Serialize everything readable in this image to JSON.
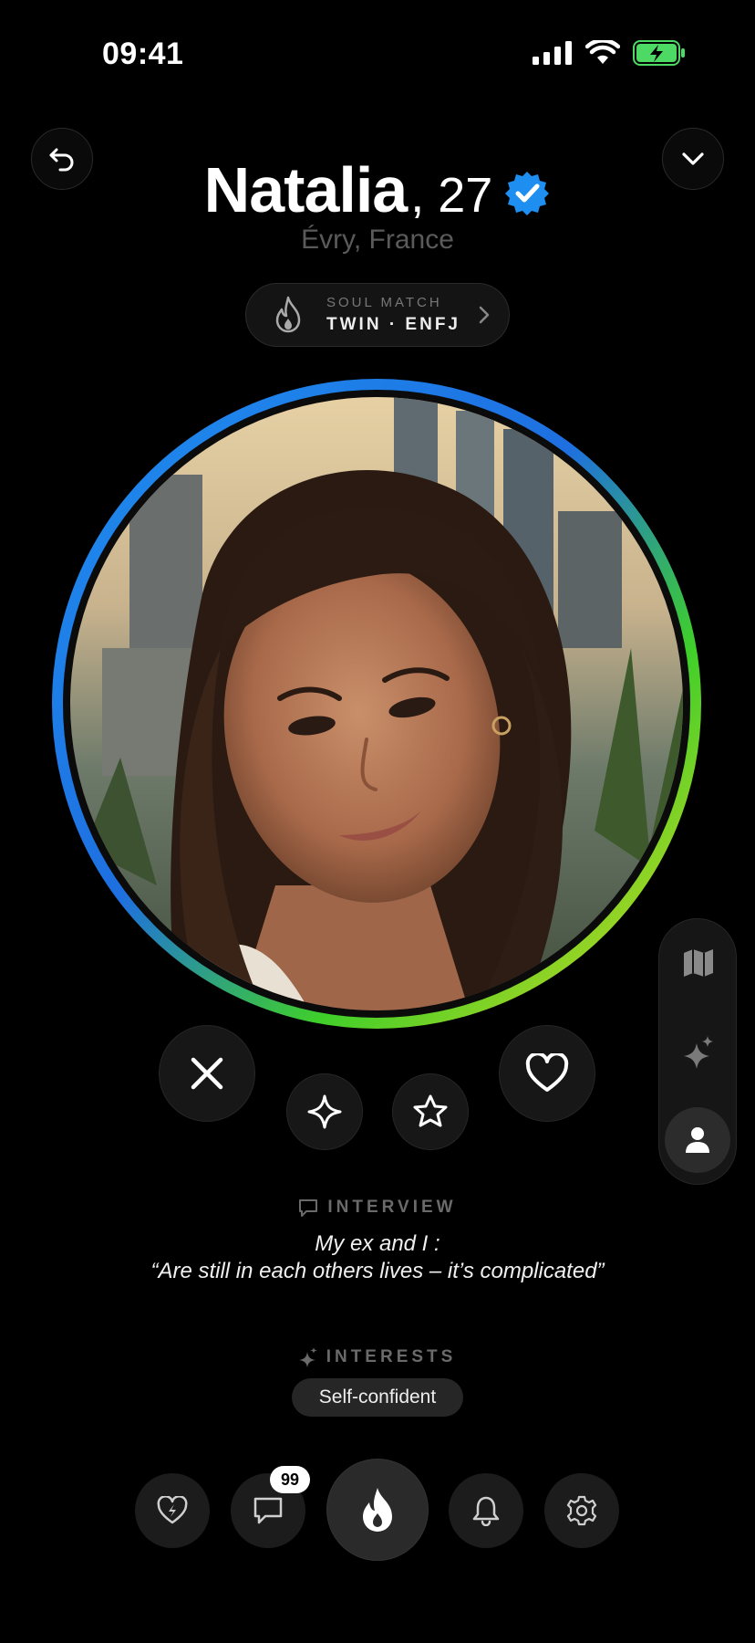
{
  "status_bar": {
    "time": "09:41"
  },
  "profile": {
    "name": "Natalia",
    "age": ", 27",
    "location": "Évry, France",
    "verified": true
  },
  "soul_match": {
    "label": "SOUL MATCH",
    "value": "TWIN  ·  ENFJ"
  },
  "interview": {
    "label": "INTERVIEW",
    "line1": "My ex and I :",
    "line2": "“Are still in each others lives – it’s complicated”"
  },
  "interests": {
    "label": "INTERESTS",
    "items": [
      "Self-confident"
    ]
  },
  "nav": {
    "messages_badge": "99"
  },
  "colors": {
    "accent_blue": "#1e8ff0",
    "ring_green": "#3fcf2a",
    "ring_yellow": "#e6d820",
    "battery_green": "#4cd964"
  },
  "icons": {
    "top_left": "back-arrow-icon",
    "top_right": "chevron-down-icon",
    "actions": [
      "close-icon",
      "sparkle-icon",
      "star-icon",
      "heart-icon"
    ],
    "side": [
      "map-icon",
      "sparkles-icon",
      "person-icon"
    ],
    "nav": [
      "heart-bolt-icon",
      "chat-icon",
      "flame-icon",
      "bell-icon",
      "gear-icon"
    ]
  }
}
